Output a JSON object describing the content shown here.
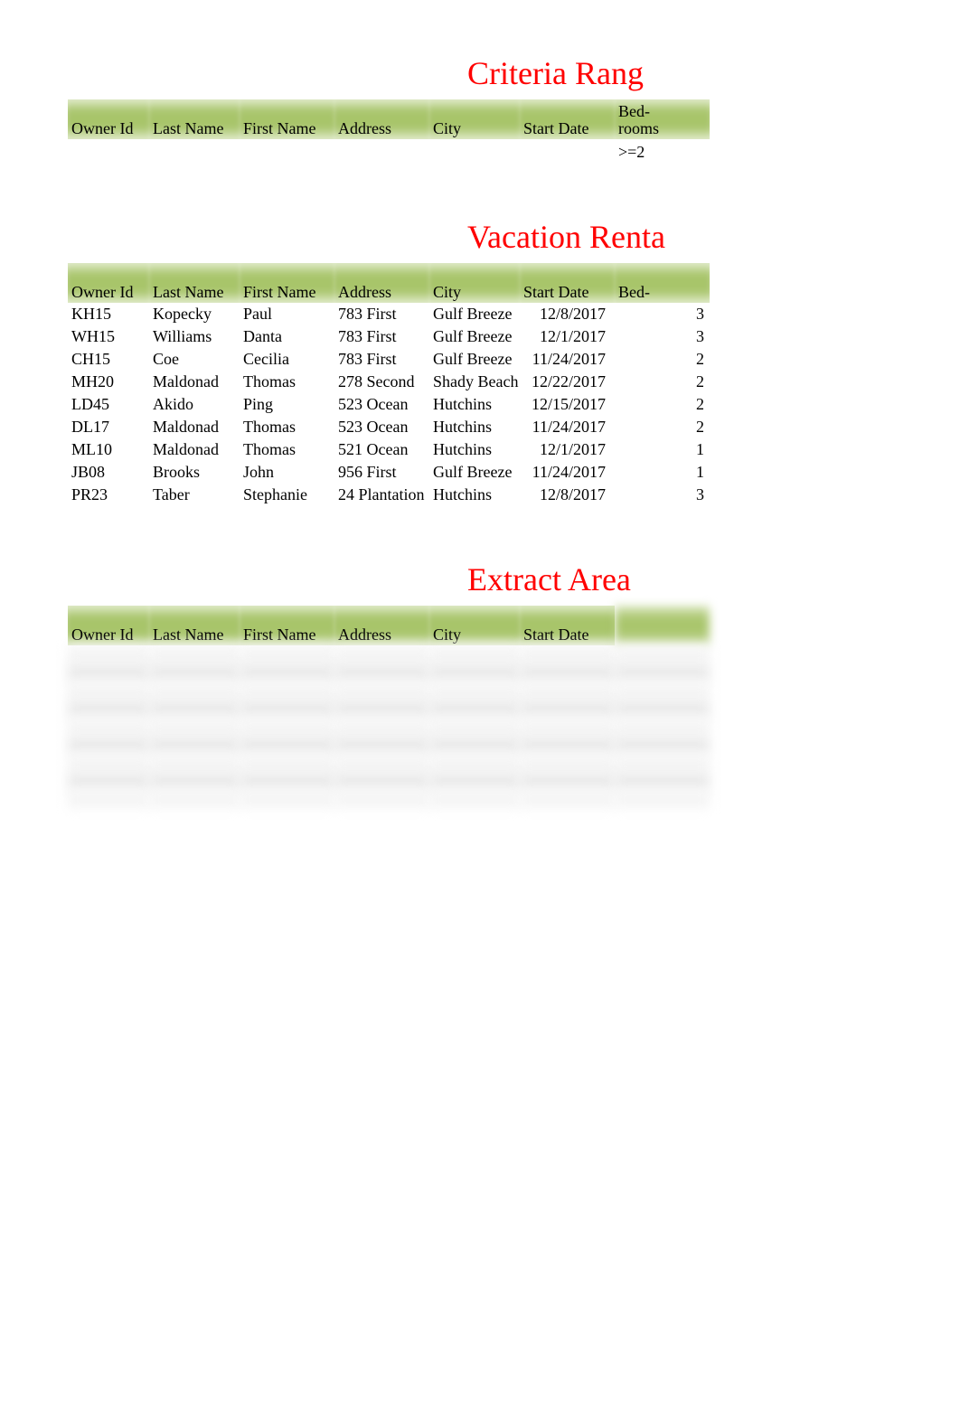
{
  "criteria": {
    "title": "Criteria Rang",
    "headers": {
      "owner": "Owner Id",
      "last": "Last Name",
      "first": "First Name",
      "addr": "Address",
      "city": "City",
      "date": "Start Date",
      "bed": "Bed-\nrooms"
    },
    "values": {
      "owner": "",
      "last": "",
      "first": "",
      "addr": "",
      "city": "",
      "date": "",
      "bed": ">=2"
    }
  },
  "rentals": {
    "title": "Vacation Renta",
    "headers": {
      "owner": "Owner Id",
      "last": "Last Name",
      "first": "First Name",
      "addr": "Address",
      "city": "City",
      "date": "Start Date",
      "bed": "Bed-"
    },
    "rows": [
      {
        "owner": "KH15",
        "last": "Kopecky",
        "first": "Paul",
        "addr": "783 First",
        "city": "Gulf Breeze",
        "date": "12/8/2017",
        "bed": "3"
      },
      {
        "owner": "WH15",
        "last": "Williams",
        "first": "Danta",
        "addr": "783 First",
        "city": "Gulf Breeze",
        "date": "12/1/2017",
        "bed": "3"
      },
      {
        "owner": "CH15",
        "last": "Coe",
        "first": "Cecilia",
        "addr": "783 First",
        "city": "Gulf Breeze",
        "date": "11/24/2017",
        "bed": "2"
      },
      {
        "owner": "MH20",
        "last": "Maldonad",
        "first": "Thomas",
        "addr": "278 Second",
        "city": "Shady Beach",
        "date": "12/22/2017",
        "bed": "2"
      },
      {
        "owner": "LD45",
        "last": "Akido",
        "first": "Ping",
        "addr": "523 Ocean",
        "city": "Hutchins",
        "date": "12/15/2017",
        "bed": "2"
      },
      {
        "owner": "DL17",
        "last": "Maldonad",
        "first": "Thomas",
        "addr": "523 Ocean",
        "city": "Hutchins",
        "date": "11/24/2017",
        "bed": "2"
      },
      {
        "owner": "ML10",
        "last": "Maldonad",
        "first": "Thomas",
        "addr": "521 Ocean",
        "city": "Hutchins",
        "date": "12/1/2017",
        "bed": "1"
      },
      {
        "owner": "JB08",
        "last": "Brooks",
        "first": "John",
        "addr": "956 First",
        "city": "Gulf Breeze",
        "date": "11/24/2017",
        "bed": "1"
      },
      {
        "owner": "PR23",
        "last": "Taber",
        "first": "Stephanie",
        "addr": "24 Plantation",
        "city": "Hutchins",
        "date": "12/8/2017",
        "bed": "3"
      }
    ]
  },
  "extract": {
    "title": "Extract Area",
    "headers": {
      "owner": "Owner Id",
      "last": "Last Name",
      "first": "First Name",
      "addr": "Address",
      "city": "City",
      "date": "Start Date",
      "bed": ""
    }
  }
}
